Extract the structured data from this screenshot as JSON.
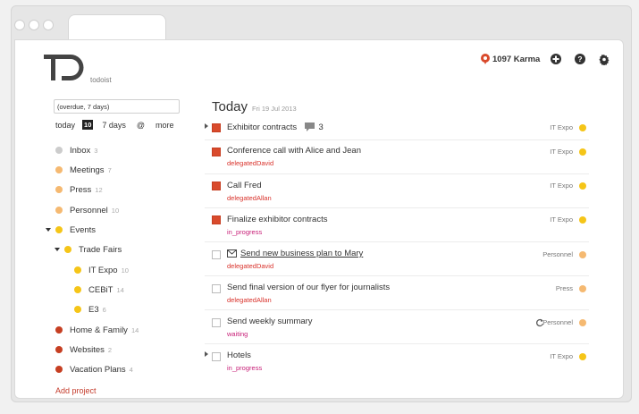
{
  "app": {
    "logo_text": "todoist",
    "karma": "1097 Karma",
    "colors": {
      "accent": "#d94a2c",
      "yellow": "#f5c518",
      "orange": "#f5b971",
      "grey": "#cccccc",
      "red": "#c63f22"
    }
  },
  "header_icons": [
    "add-icon",
    "help-icon",
    "settings-gear-icon"
  ],
  "sidebar": {
    "filter_value": "(overdue, 7 days)",
    "quicknav": {
      "today": "today",
      "today_count": "10",
      "seven_days": "7 days",
      "at": "@",
      "more": "more"
    },
    "projects": [
      {
        "name": "Inbox",
        "count": "3",
        "color": "#cccccc"
      },
      {
        "name": "Meetings",
        "count": "7",
        "color": "#f5b971"
      },
      {
        "name": "Press",
        "count": "12",
        "color": "#f5b971"
      },
      {
        "name": "Personnel",
        "count": "10",
        "color": "#f5b971"
      },
      {
        "name": "Events",
        "count": "",
        "color": "#f5c518"
      },
      {
        "name": "Trade Fairs",
        "count": "",
        "color": "#f5c518"
      },
      {
        "name": "IT Expo",
        "count": "10",
        "color": "#f5c518"
      },
      {
        "name": "CEBiT",
        "count": "14",
        "color": "#f5c518"
      },
      {
        "name": "E3",
        "count": "6",
        "color": "#f5c518"
      },
      {
        "name": "Home & Family",
        "count": "14",
        "color": "#c63f22"
      },
      {
        "name": "Websites",
        "count": "2",
        "color": "#c63f22"
      },
      {
        "name": "Vacation Plans",
        "count": "4",
        "color": "#c63f22"
      }
    ],
    "add_project": "Add project"
  },
  "main": {
    "title": "Today",
    "date": "Fri 19 Jul 2013",
    "tasks": [
      {
        "content": "Exhibitor contracts",
        "comments": "3",
        "label": "",
        "project": "IT Expo",
        "project_color": "#f5c518",
        "priority": "red"
      },
      {
        "content": "Conference call with Alice and Jean",
        "label": "delegatedDavid",
        "project": "IT Expo",
        "project_color": "#f5c518",
        "priority": "red"
      },
      {
        "content": "Call Fred",
        "label": "delegatedAllan",
        "project": "IT Expo",
        "project_color": "#f5c518",
        "priority": "red"
      },
      {
        "content": "Finalize exhibitor contracts",
        "label": "in_progress",
        "project": "IT Expo",
        "project_color": "#f5c518",
        "priority": "red"
      },
      {
        "content": "Send new business plan to Mary",
        "label": "delegatedDavid",
        "project": "Personnel",
        "project_color": "#f5b971",
        "priority": "none"
      },
      {
        "content": "Send final version of our flyer for journalists",
        "label": "delegatedAllan",
        "project": "Press",
        "project_color": "#f5b971",
        "priority": "none"
      },
      {
        "content": "Send weekly summary",
        "label": "waiting",
        "project": "Personnel",
        "project_color": "#f5b971",
        "priority": "none"
      },
      {
        "content": "Hotels",
        "label": "in_progress",
        "project": "IT Expo",
        "project_color": "#f5c518",
        "priority": "none"
      }
    ]
  }
}
